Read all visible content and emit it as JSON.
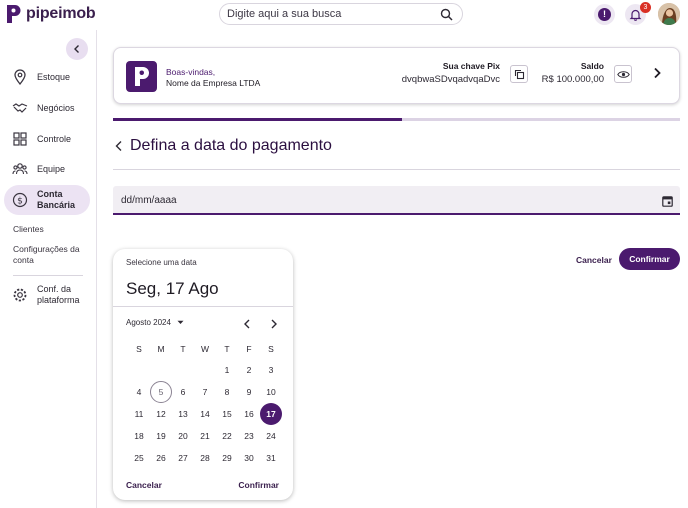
{
  "brand": {
    "name": "pipeimob",
    "color": "#4b1a6e"
  },
  "search": {
    "placeholder": "Digite aqui a sua busca"
  },
  "header": {
    "notification_count": "3",
    "alert_symbol": "!"
  },
  "sidebar": {
    "items": [
      {
        "label": "Estoque",
        "icon": "location-pin-icon"
      },
      {
        "label": "Negócios",
        "icon": "handshake-icon"
      },
      {
        "label": "Controle",
        "icon": "grid-icon"
      },
      {
        "label": "Equipe",
        "icon": "team-icon"
      },
      {
        "label": "Conta Bancária",
        "icon": "dollar-circle-icon",
        "active": true
      }
    ],
    "sub_items": [
      "Clientes",
      "Configurações da conta"
    ],
    "footer_item": {
      "label": "Conf. da plataforma",
      "icon": "gear-icon"
    }
  },
  "account": {
    "welcome": "Boas-vindas,",
    "company": "Nome da Empresa LTDA",
    "pix_title": "Sua chave Pix",
    "pix_key": "dvqbwaSDvqadvqaDvc",
    "balance_title": "Saldo",
    "balance_value": "R$ 100.000,00"
  },
  "progress": {
    "fraction": 0.51
  },
  "step": {
    "title": "Defina a data do pagamento"
  },
  "date_input": {
    "placeholder": "dd/mm/aaaa"
  },
  "actions": {
    "cancel": "Cancelar",
    "confirm": "Confirmar"
  },
  "picker": {
    "title": "Selecione uma data",
    "selected_label": "Seg, 17 Ago",
    "month_label": "Agosto 2024",
    "weekdays": [
      "S",
      "M",
      "T",
      "W",
      "T",
      "F",
      "S"
    ],
    "first_weekday_index": 4,
    "days_in_month": 31,
    "today": 5,
    "selected": 17,
    "cancel": "Cancelar",
    "confirm": "Confirmar"
  }
}
